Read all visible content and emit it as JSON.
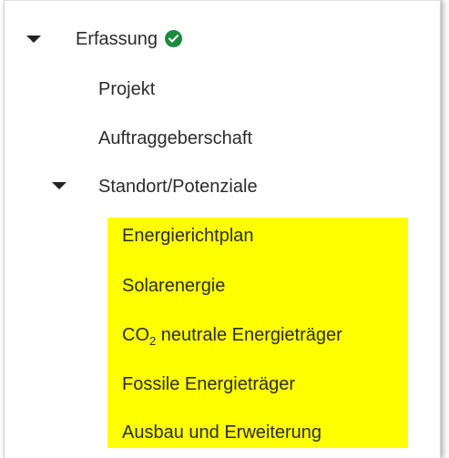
{
  "tree": {
    "root": {
      "label": "Erfassung",
      "status_icon": "check-circle-icon",
      "expanded": true
    },
    "children": [
      {
        "label": "Projekt"
      },
      {
        "label": "Auftraggeberschaft"
      }
    ],
    "group": {
      "label": "Standort/Potenziale",
      "expanded": true,
      "items": [
        {
          "label": "Energierichtplan"
        },
        {
          "label": "Solarenergie"
        },
        {
          "label_prefix": "CO",
          "label_sub": "2",
          "label_suffix": " neutrale Energieträger"
        },
        {
          "label": "Fossile Energieträger"
        },
        {
          "label": "Ausbau und Erweiterung"
        }
      ]
    }
  },
  "colors": {
    "highlight": "#ffff00",
    "check_green": "#1e8a3f",
    "text": "#2b2b2b"
  }
}
